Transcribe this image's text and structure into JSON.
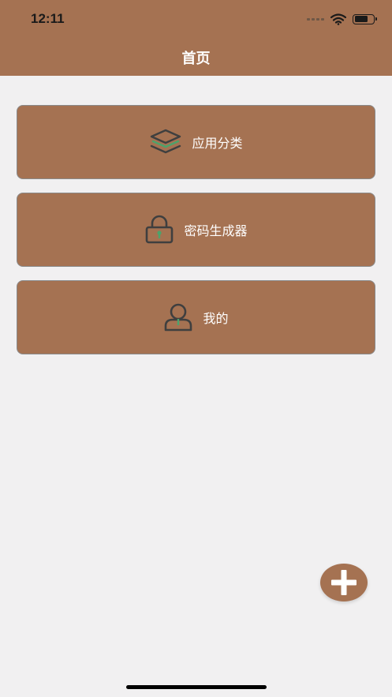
{
  "status_bar": {
    "time": "12:11"
  },
  "nav": {
    "title": "首页"
  },
  "menu": [
    {
      "label": "应用分类",
      "icon": "layers-icon"
    },
    {
      "label": "密码生成器",
      "icon": "lock-icon"
    },
    {
      "label": "我的",
      "icon": "user-icon"
    }
  ],
  "fab": {
    "icon": "plus-icon"
  },
  "colors": {
    "primary": "#a57252",
    "background": "#f1f0f1",
    "icon_stroke": "#3f3f3f",
    "icon_accent": "#4ca36b",
    "text_on_primary": "#ffffff"
  }
}
